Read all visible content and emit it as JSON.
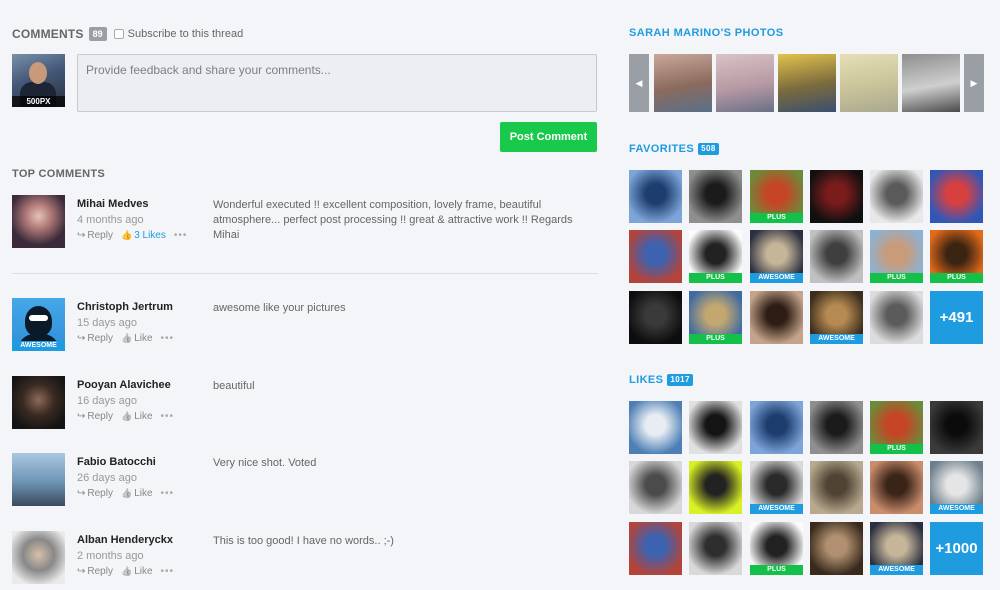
{
  "comments": {
    "title": "COMMENTS",
    "count": "89",
    "subscribe_label": "Subscribe to this thread",
    "input_placeholder": "Provide feedback and share your comments...",
    "my_avatar_tag": "500PX",
    "post_button": "Post Comment",
    "top_title": "TOP COMMENTS",
    "items": [
      {
        "name": "Mihai Medves",
        "time": "4 months ago",
        "reply": "Reply",
        "likes": "3 Likes",
        "liked": true,
        "text": "Wonderful executed !! excellent composition, lovely frame, beautiful atmosphere... perfect post processing !! great & attractive work !! Regards Mihai",
        "badge": ""
      },
      {
        "name": "Christoph Jertrum",
        "time": "15 days ago",
        "reply": "Reply",
        "likes": "Like",
        "liked": false,
        "text": "awesome like your pictures",
        "badge": "AWESOME"
      },
      {
        "name": "Pooyan Alavichee",
        "time": "16 days ago",
        "reply": "Reply",
        "likes": "Like",
        "liked": false,
        "text": "beautiful",
        "badge": ""
      },
      {
        "name": "Fabio Batocchi",
        "time": "26 days ago",
        "reply": "Reply",
        "likes": "Like",
        "liked": false,
        "text": "Very nice shot. Voted",
        "badge": ""
      },
      {
        "name": "Alban Henderyckx",
        "time": "2 months ago",
        "reply": "Reply",
        "likes": "Like",
        "liked": false,
        "text": "This is too good! I have no words.. ;-)",
        "badge": ""
      }
    ],
    "more_glyph": "•••",
    "reply_icon": "reply-icon",
    "like_icon": "thumbs-up-icon"
  },
  "photos": {
    "title": "SARAH MARINO'S PHOTOS",
    "prev_icon": "chevron-left-icon",
    "next_icon": "chevron-right-icon",
    "thumb_colors": [
      [
        "#c9a89a",
        "#8a6b5d",
        "#5b6f8a"
      ],
      [
        "#d8c3c6",
        "#b79aa4",
        "#6a6f86"
      ],
      [
        "#e3c24c",
        "#7b6b3e",
        "#3b4f6e"
      ],
      [
        "#e6dfb5",
        "#c9c39a",
        "#a9a890"
      ],
      [
        "#8e8e8e",
        "#cfcfcf",
        "#4a4a4a"
      ]
    ]
  },
  "favorites": {
    "title": "FAVORITES",
    "count": "508",
    "more": "+491",
    "cells": [
      {
        "colors": [
          "#7da5d9",
          "#1d3d6e"
        ],
        "badge": ""
      },
      {
        "colors": [
          "#8f8f8f",
          "#1b1b1b"
        ],
        "badge": ""
      },
      {
        "colors": [
          "#6b8b3b",
          "#c64524"
        ],
        "badge": "PLUS"
      },
      {
        "colors": [
          "#101010",
          "#7a1c1c"
        ],
        "badge": ""
      },
      {
        "colors": [
          "#e8e8e8",
          "#5a5a5a"
        ],
        "badge": ""
      },
      {
        "colors": [
          "#3057b8",
          "#d84040"
        ],
        "badge": ""
      },
      {
        "colors": [
          "#b4443a",
          "#3d62b0"
        ],
        "badge": ""
      },
      {
        "colors": [
          "#fbfbfb",
          "#222222"
        ],
        "badge": "PLUS"
      },
      {
        "colors": [
          "#2b3040",
          "#c7b59a"
        ],
        "badge": "AWESOME"
      },
      {
        "colors": [
          "#c0c0c0",
          "#3f3f3f"
        ],
        "badge": ""
      },
      {
        "colors": [
          "#8bb2d5",
          "#c99b7b"
        ],
        "badge": "PLUS"
      },
      {
        "colors": [
          "#e16a1b",
          "#3a2412"
        ],
        "badge": "PLUS"
      },
      {
        "colors": [
          "#0d0d0d",
          "#3a3a3a"
        ],
        "badge": ""
      },
      {
        "colors": [
          "#3f6aa2",
          "#c2a770"
        ],
        "badge": "PLUS"
      },
      {
        "colors": [
          "#c4a38a",
          "#2d1d14"
        ],
        "badge": ""
      },
      {
        "colors": [
          "#3b2c1d",
          "#b68a52"
        ],
        "badge": "AWESOME"
      },
      {
        "colors": [
          "#dcdcdc",
          "#5b5b5b"
        ],
        "badge": ""
      }
    ]
  },
  "likes": {
    "title": "LIKES",
    "count": "1017",
    "more": "+1000",
    "cells": [
      {
        "colors": [
          "#4d7fb5",
          "#e8edf3"
        ],
        "badge": ""
      },
      {
        "colors": [
          "#e0e0e0",
          "#141414"
        ],
        "badge": ""
      },
      {
        "colors": [
          "#7da5d9",
          "#1d3d6e"
        ],
        "badge": ""
      },
      {
        "colors": [
          "#8f8f8f",
          "#1b1b1b"
        ],
        "badge": ""
      },
      {
        "colors": [
          "#6b8b3b",
          "#c64524"
        ],
        "badge": "PLUS"
      },
      {
        "colors": [
          "#3a3a3a",
          "#0b0b0b"
        ],
        "badge": ""
      },
      {
        "colors": [
          "#d8d8d8",
          "#4b4b4b"
        ],
        "badge": ""
      },
      {
        "colors": [
          "#d8f024",
          "#222222"
        ],
        "badge": ""
      },
      {
        "colors": [
          "#d9d9d9",
          "#2a2a2a"
        ],
        "badge": "AWESOME"
      },
      {
        "colors": [
          "#b7a88f",
          "#4f4433"
        ],
        "badge": ""
      },
      {
        "colors": [
          "#c98c6c",
          "#3a2418"
        ],
        "badge": ""
      },
      {
        "colors": [
          "#6d7f8c",
          "#e5e5e5"
        ],
        "badge": "AWESOME"
      },
      {
        "colors": [
          "#b4443a",
          "#3d62b0"
        ],
        "badge": ""
      },
      {
        "colors": [
          "#d9d9d9",
          "#2e2e2e"
        ],
        "badge": ""
      },
      {
        "colors": [
          "#fbfbfb",
          "#222222"
        ],
        "badge": "PLUS"
      },
      {
        "colors": [
          "#3a2a1d",
          "#b09070"
        ],
        "badge": ""
      },
      {
        "colors": [
          "#2b3040",
          "#c7b59a"
        ],
        "badge": "AWESOME"
      }
    ]
  }
}
